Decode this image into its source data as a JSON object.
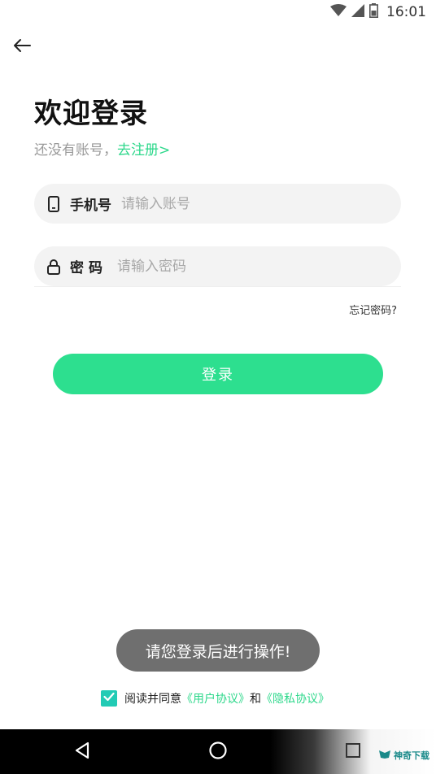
{
  "status_bar": {
    "time": "16:01",
    "icons": [
      "wifi-icon",
      "signal-icon",
      "battery-icon"
    ]
  },
  "header": {
    "back_icon": "arrow-left-icon"
  },
  "login": {
    "title": "欢迎登录",
    "subtitle_prefix": "还没有账号，",
    "register_link": "去注册>",
    "phone": {
      "icon": "phone-icon",
      "label": "手机号",
      "placeholder": "请输入账号",
      "value": ""
    },
    "password": {
      "icon": "lock-icon",
      "label": "密码",
      "placeholder": "请输入密码",
      "value": ""
    },
    "forgot_password": "忘记密码?",
    "login_button": "登录"
  },
  "toast": {
    "message": "请您登录后进行操作!"
  },
  "agreement": {
    "checked": true,
    "prefix": "阅读并同意",
    "user_agreement": "《用户协议》",
    "and": "和",
    "privacy_policy": "《隐私协议》"
  },
  "nav_bar": {
    "buttons": [
      "back-triangle-icon",
      "home-circle-icon",
      "recents-square-icon"
    ]
  },
  "watermark": {
    "text": "神奇下载"
  },
  "colors": {
    "accent": "#2dd88b",
    "button": "#2ddf8f",
    "checkbox": "#22cbb5",
    "toast": "#6f6f6f"
  }
}
